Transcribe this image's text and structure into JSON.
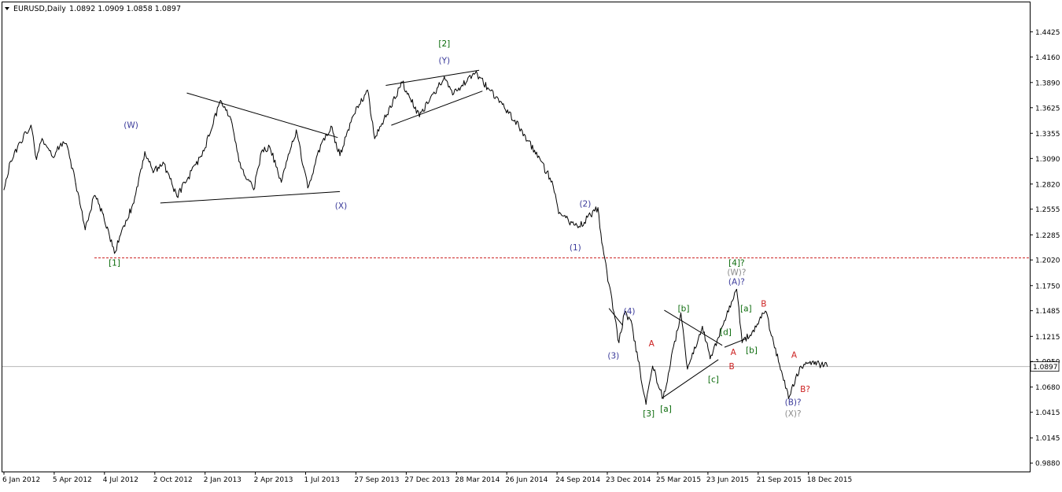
{
  "header": {
    "symbol_label": "EURUSD,Daily",
    "ohlc": "1.0892 1.0909 1.0858 1.0897"
  },
  "colors": {
    "price": "#000000",
    "wave_blue": "#3a3a9a",
    "wave_green": "#0a6a0a",
    "wave_red": "#cc2020",
    "wave_gray": "#8a8a8a",
    "support_red": "#cc2020",
    "current_line": "#b8b8b8"
  },
  "chart_data": {
    "type": "line",
    "title": "EURUSD,Daily",
    "ylim": [
      0.979,
      1.4735
    ],
    "y_ticks": [
      "1.4425",
      "1.4160",
      "1.3890",
      "1.3625",
      "1.3355",
      "1.3090",
      "1.2820",
      "1.2555",
      "1.2285",
      "1.2020",
      "1.1750",
      "1.1485",
      "1.1215",
      "1.0950",
      "1.0680",
      "1.0415",
      "1.0145",
      "0.9880"
    ],
    "x_ticks": [
      "6 Jan 2012",
      "5 Apr 2012",
      "4 Jul 2012",
      "2 Oct 2012",
      "2 Jan 2013",
      "2 Apr 2013",
      "1 Jul 2013",
      "27 Sep 2013",
      "27 Dec 2013",
      "28 Mar 2014",
      "26 Jun 2014",
      "24 Sep 2014",
      "23 Dec 2014",
      "25 Mar 2015",
      "23 Jun 2015",
      "21 Sep 2015",
      "18 Dec 2015"
    ],
    "last_price": "1.0897",
    "support_level": 1.2042,
    "series": [
      {
        "values": [
          [
            "6 Jan 2012",
            1.276
          ],
          [
            "18 Jan 2012",
            1.306
          ],
          [
            "5 Feb 2012",
            1.326
          ],
          [
            "24 Feb 2012",
            1.344
          ],
          [
            "5 Mar 2012",
            1.308
          ],
          [
            "15 Mar 2012",
            1.33
          ],
          [
            "5 Apr 2012",
            1.31
          ],
          [
            "18 Apr 2012",
            1.325
          ],
          [
            "30 Apr 2012",
            1.321
          ],
          [
            "15 May 2012",
            1.282
          ],
          [
            "1 Jun 2012",
            1.234
          ],
          [
            "18 Jun 2012",
            1.27
          ],
          [
            "4 Jul 2012",
            1.25
          ],
          [
            "24 Jul 2012",
            1.209
          ],
          [
            "10 Aug 2012",
            1.238
          ],
          [
            "28 Aug 2012",
            1.262
          ],
          [
            "17 Sep 2012",
            1.316
          ],
          [
            "2 Oct 2012",
            1.294
          ],
          [
            "20 Oct 2012",
            1.305
          ],
          [
            "14 Nov 2012",
            1.269
          ],
          [
            "2 Jan 2013",
            1.317
          ],
          [
            "1 Feb 2013",
            1.37
          ],
          [
            "20 Feb 2013",
            1.35
          ],
          [
            "10 Mar 2013",
            1.299
          ],
          [
            "2 Apr 2013",
            1.276
          ],
          [
            "16 Apr 2013",
            1.316
          ],
          [
            "1 May 2013",
            1.321
          ],
          [
            "22 May 2013",
            1.284
          ],
          [
            "18 Jun 2013",
            1.339
          ],
          [
            "1 Jul 2013",
            1.3
          ],
          [
            "9 Jul 2013",
            1.278
          ],
          [
            "1 Aug 2013",
            1.323
          ],
          [
            "20 Aug 2013",
            1.343
          ],
          [
            "5 Sep 2013",
            1.312
          ],
          [
            "27 Sep 2013",
            1.352
          ],
          [
            "25 Oct 2013",
            1.381
          ],
          [
            "7 Nov 2013",
            1.33
          ],
          [
            "27 Dec 2013",
            1.389
          ],
          [
            "27 Jan 2014",
            1.353
          ],
          [
            "13 Mar 2014",
            1.395
          ],
          [
            "28 Mar 2014",
            1.376
          ],
          [
            "8 May 2014",
            1.399
          ],
          [
            "26 Jun 2014",
            1.366
          ],
          [
            "30 Jul 2014",
            1.34
          ],
          [
            "24 Sep 2014",
            1.285
          ],
          [
            "6 Oct 2014",
            1.251
          ],
          [
            "10 Nov 2014",
            1.236
          ],
          [
            "16 Dec 2014",
            1.257
          ],
          [
            "23 Dec 2014",
            1.22
          ],
          [
            "23 Jan 2015",
            1.115
          ],
          [
            "2 Feb 2015",
            1.146
          ],
          [
            "14 Feb 2015",
            1.138
          ],
          [
            "13 Mar 2015",
            1.05
          ],
          [
            "25 Mar 2015",
            1.09
          ],
          [
            "13 Apr 2015",
            1.056
          ],
          [
            "15 May 2015",
            1.146
          ],
          [
            "27 May 2015",
            1.087
          ],
          [
            "23 Jun 2015",
            1.132
          ],
          [
            "7 Jul 2015",
            1.098
          ],
          [
            "24 Aug 2015",
            1.171
          ],
          [
            "3 Sep 2015",
            1.115
          ],
          [
            "21 Sep 2015",
            1.126
          ],
          [
            "15 Oct 2015",
            1.148
          ],
          [
            "26 Nov 2015",
            1.056
          ],
          [
            "18 Dec 2015",
            1.09
          ],
          [
            "4 Jan 2016",
            1.095
          ],
          [
            "4 Feb 2016",
            1.09
          ]
        ]
      }
    ],
    "trendlines": [
      {
        "from": [
          "2 Dec 2012",
          1.378
        ],
        "to": [
          "1 Sep 2013",
          1.331
        ]
      },
      {
        "from": [
          "15 Oct 2012",
          1.262
        ],
        "to": [
          "5 Sep 2013",
          1.274
        ]
      },
      {
        "from": [
          "27 Nov 2013",
          1.386
        ],
        "to": [
          "15 May 2014",
          1.402
        ]
      },
      {
        "from": [
          "7 Dec 2013",
          1.344
        ],
        "to": [
          "21 May 2014",
          1.38
        ]
      },
      {
        "from": [
          "5 Jan 2015",
          1.151
        ],
        "to": [
          "30 Jan 2015",
          1.133
        ]
      },
      {
        "from": [
          "10 Apr 2015",
          1.056
        ],
        "to": [
          "22 Jul 2015",
          1.097
        ]
      },
      {
        "from": [
          "15 Apr 2015",
          1.149
        ],
        "to": [
          "29 Jul 2015",
          1.112
        ]
      },
      {
        "from": [
          "2 Aug 2015",
          1.11
        ],
        "to": [
          "10 Sep 2015",
          1.119
        ]
      }
    ],
    "annotations": [
      {
        "text": "(W)",
        "at": [
          "23 Aug 2012",
          1.341
        ],
        "color": "wave_blue"
      },
      {
        "text": "(X)",
        "at": [
          "7 Sep 2013",
          1.256
        ],
        "color": "wave_blue"
      },
      {
        "text": "[2]",
        "at": [
          "13 Mar 2014",
          1.427
        ],
        "color": "wave_green"
      },
      {
        "text": "(Y)",
        "at": [
          "13 Mar 2014",
          1.409
        ],
        "color": "wave_blue"
      },
      {
        "text": "[1]",
        "at": [
          "24 Jul 2012",
          1.196
        ],
        "color": "wave_green"
      },
      {
        "text": "(2)",
        "at": [
          "23 Nov 2014",
          1.258
        ],
        "color": "wave_blue"
      },
      {
        "text": "(1)",
        "at": [
          "5 Nov 2014",
          1.212
        ],
        "color": "wave_blue"
      },
      {
        "text": "(4)",
        "at": [
          "11 Feb 2015",
          1.145
        ],
        "color": "wave_blue"
      },
      {
        "text": "(3)",
        "at": [
          "13 Jan 2015",
          1.098
        ],
        "color": "wave_blue"
      },
      {
        "text": "[3]",
        "at": [
          "18 Mar 2015",
          1.037
        ],
        "color": "wave_green"
      },
      {
        "text": "[a]",
        "at": [
          "18 Apr 2015",
          1.042
        ],
        "color": "wave_green"
      },
      {
        "text": "A",
        "at": [
          "23 Mar 2015",
          1.111
        ],
        "color": "wave_red"
      },
      {
        "text": "[b]",
        "at": [
          "20 May 2015",
          1.148
        ],
        "color": "wave_green"
      },
      {
        "text": "[c]",
        "at": [
          "13 Jul 2015",
          1.073
        ],
        "color": "wave_green"
      },
      {
        "text": "B",
        "at": [
          "15 Aug 2015",
          1.087
        ],
        "color": "wave_red"
      },
      {
        "text": "[d]",
        "at": [
          "4 Aug 2015",
          1.123
        ],
        "color": "wave_green"
      },
      {
        "text": "A",
        "at": [
          "18 Aug 2015",
          1.102
        ],
        "color": "wave_red"
      },
      {
        "text": "[4]?",
        "at": [
          "24 Aug 2015",
          1.196
        ],
        "color": "wave_green"
      },
      {
        "text": "(W)?",
        "at": [
          "24 Aug 2015",
          1.186
        ],
        "color": "wave_gray"
      },
      {
        "text": "(A)?",
        "at": [
          "24 Aug 2015",
          1.176
        ],
        "color": "wave_blue"
      },
      {
        "text": "[a]",
        "at": [
          "10 Sep 2015",
          1.148
        ],
        "color": "wave_green"
      },
      {
        "text": "[b]",
        "at": [
          "20 Sep 2015",
          1.104
        ],
        "color": "wave_green"
      },
      {
        "text": "B",
        "at": [
          "12 Oct 2015",
          1.153
        ],
        "color": "wave_red"
      },
      {
        "text": "A",
        "at": [
          "6 Dec 2015",
          1.099
        ],
        "color": "wave_red"
      },
      {
        "text": "B?",
        "at": [
          "26 Dec 2015",
          1.063
        ],
        "color": "wave_red"
      },
      {
        "text": "(B)?",
        "at": [
          "4 Dec 2015",
          1.049
        ],
        "color": "wave_blue"
      },
      {
        "text": "(X)?",
        "at": [
          "4 Dec 2015",
          1.037
        ],
        "color": "wave_gray"
      }
    ]
  }
}
